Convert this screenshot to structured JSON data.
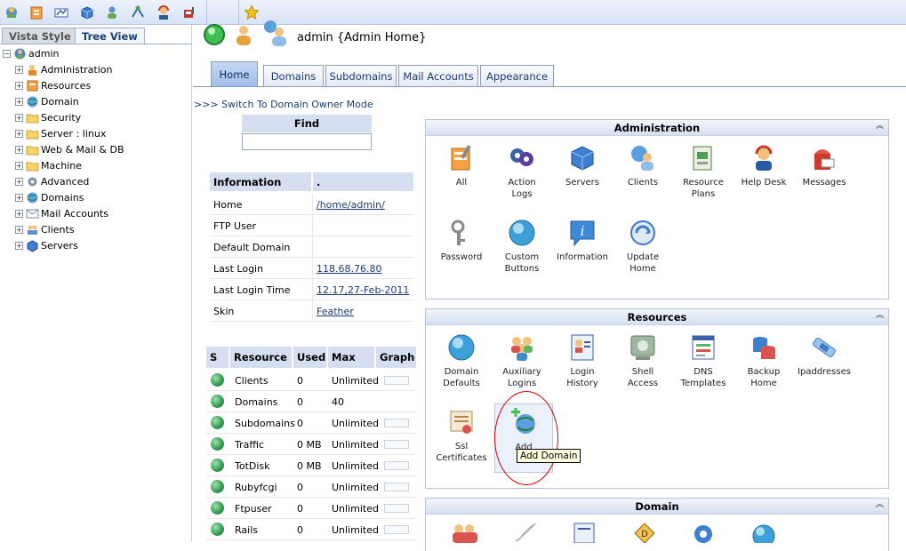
{
  "toolbar": {
    "icons": [
      "home-icon",
      "tools-icon",
      "tasks-icon",
      "package-icon",
      "user-icon",
      "network-icon",
      "helpdesk-icon",
      "mailbox-icon",
      "favorite-star-icon"
    ]
  },
  "left": {
    "tabs": [
      "Vista Style",
      "Tree View"
    ],
    "root": "admin",
    "items": [
      "Administration",
      "Resources",
      "Domain",
      "Security",
      "Server : linux",
      "Web & Mail & DB",
      "Machine",
      "Advanced",
      "Domains",
      "Mail Accounts",
      "Clients",
      "Servers"
    ]
  },
  "header": {
    "title": "admin {Admin Home}"
  },
  "tabs": [
    "Home",
    "Domains",
    "Subdomains",
    "Mail Accounts",
    "Appearance"
  ],
  "switch_link": ">>> Switch To Domain Owner Mode",
  "find": {
    "label": "Find",
    "value": ""
  },
  "info": {
    "head_key": "Information",
    "head_val": ".",
    "rows": [
      {
        "k": "Home",
        "v": "/home/admin/"
      },
      {
        "k": "FTP User",
        "v": ""
      },
      {
        "k": "Default Domain",
        "v": ""
      },
      {
        "k": "Last Login",
        "v": "118.68.76.80"
      },
      {
        "k": "Last Login Time",
        "v": "12.17,27-Feb-2011"
      },
      {
        "k": "Skin",
        "v": "Feather"
      }
    ]
  },
  "resources_table": {
    "headers": [
      "S",
      "Resource",
      "Used",
      "Max",
      "Graph"
    ],
    "rows": [
      {
        "name": "Clients",
        "used": "0",
        "max": "Unlimited"
      },
      {
        "name": "Domains",
        "used": "0",
        "max": "40"
      },
      {
        "name": "Subdomains",
        "used": "0",
        "max": "Unlimited"
      },
      {
        "name": "Traffic",
        "used": "0 MB",
        "max": "Unlimited"
      },
      {
        "name": "TotDisk",
        "used": "0 MB",
        "max": "Unlimited"
      },
      {
        "name": "Rubyfcgi",
        "used": "0",
        "max": "Unlimited"
      },
      {
        "name": "Ftpuser",
        "used": "0",
        "max": "Unlimited"
      },
      {
        "name": "Rails",
        "used": "0",
        "max": "Unlimited"
      }
    ]
  },
  "panels": {
    "administration": {
      "title": "Administration",
      "items": [
        [
          "All"
        ],
        [
          "Action",
          "Logs"
        ],
        [
          "Servers"
        ],
        [
          "Clients"
        ],
        [
          "Resource",
          "Plans"
        ],
        [
          "Help Desk"
        ],
        [
          "Messages"
        ],
        [
          "Password"
        ],
        [
          "Custom",
          "Buttons"
        ],
        [
          "Information"
        ],
        [
          "Update",
          "Home"
        ]
      ]
    },
    "resources": {
      "title": "Resources",
      "items": [
        [
          "Domain",
          "Defaults"
        ],
        [
          "Auxiliary",
          "Logins"
        ],
        [
          "Login",
          "History"
        ],
        [
          "Shell",
          "Access"
        ],
        [
          "DNS",
          "Templates"
        ],
        [
          "Backup",
          "Home"
        ],
        [
          "Ipaddresses"
        ],
        [
          "Ssl",
          "Certificates"
        ],
        [
          "Add",
          "Do"
        ]
      ]
    },
    "domain": {
      "title": "Domain"
    }
  },
  "tooltip": "Add Domain"
}
